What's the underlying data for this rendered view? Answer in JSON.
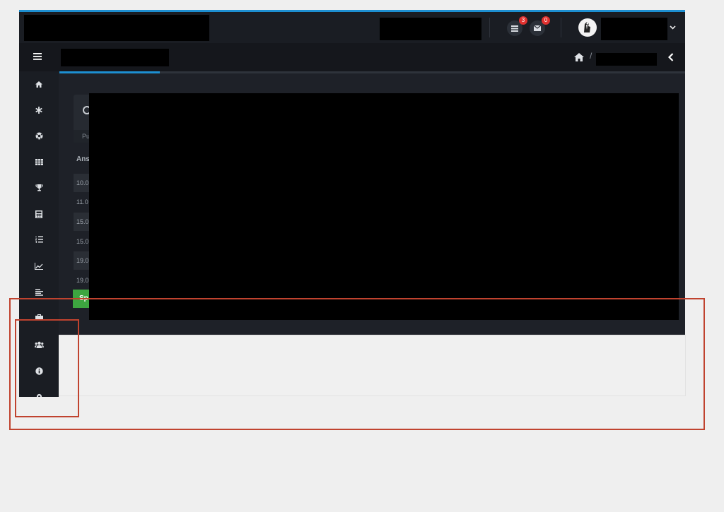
{
  "header": {
    "notifications": {
      "label": "3",
      "icon": "list-icon"
    },
    "messages": {
      "label": "0",
      "icon": "envelope-icon"
    },
    "user_menu_icon": "chevron-down-icon"
  },
  "sub_header": {
    "menu_icon": "hamburger-icon",
    "breadcrumb_home_icon": "home-icon",
    "breadcrumb_separator": "/",
    "collapse_icon": "chevron-left-icon"
  },
  "progress": {
    "fraction": 0.16,
    "color": "#1d8fd1"
  },
  "sidebar": {
    "items": [
      {
        "icon": "home-icon"
      },
      {
        "icon": "asterisk-icon"
      },
      {
        "icon": "soccer-ball-icon"
      },
      {
        "icon": "table-icon"
      },
      {
        "icon": "trophy-icon"
      },
      {
        "icon": "calculator-icon"
      },
      {
        "icon": "ordered-list-icon"
      },
      {
        "icon": "line-chart-icon"
      },
      {
        "icon": "align-left-icon"
      },
      {
        "icon": "briefcase-icon"
      },
      {
        "icon": "users-icon"
      },
      {
        "icon": "info-circle-icon"
      },
      {
        "icon": "cog-icon"
      }
    ]
  },
  "main": {
    "card_subtitle": "Pu",
    "column_label": "Ans",
    "rows": [
      "10.0",
      "11.0",
      "15.0",
      "15.0",
      "19.0",
      "19.0"
    ],
    "button_label": "Sp"
  },
  "colors": {
    "accent": "#1d8fd1",
    "badge": "#e0312f",
    "button": "#3da640",
    "annotation": "#c0432f"
  }
}
